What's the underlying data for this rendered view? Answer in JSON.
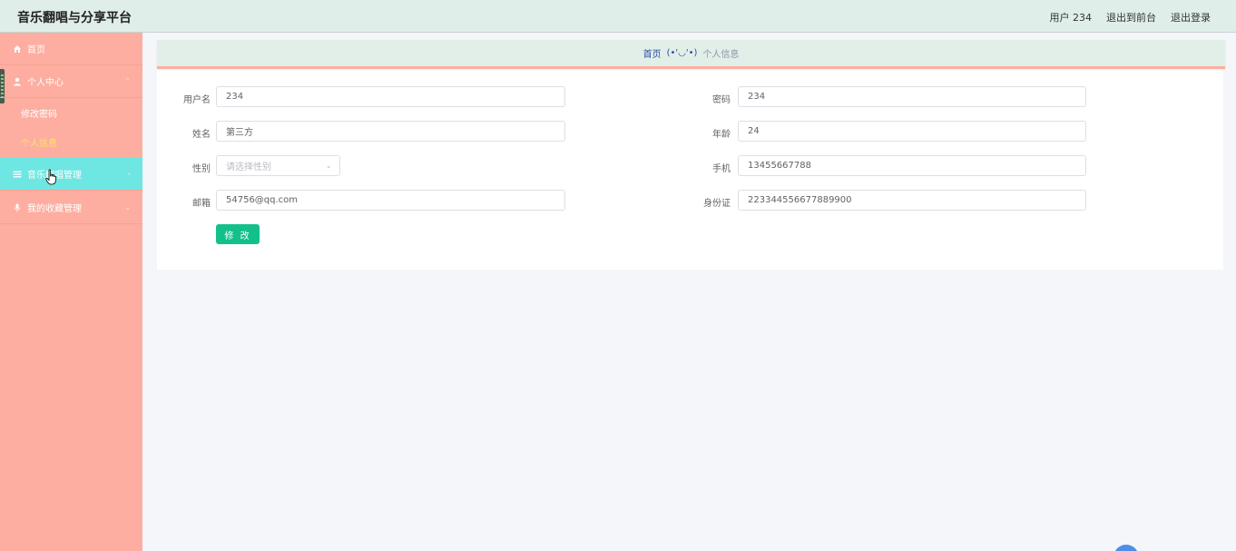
{
  "header": {
    "title": "音乐翻唱与分享平台",
    "user": "用户 234",
    "back_front": "退出到前台",
    "logout": "退出登录"
  },
  "sidebar": {
    "items": [
      {
        "label": "首页",
        "icon": "home-icon"
      },
      {
        "label": "个人中心",
        "icon": "user-icon"
      },
      {
        "label": "音乐翻唱管理",
        "icon": "list-icon"
      },
      {
        "label": "我的收藏管理",
        "icon": "microphone-icon"
      }
    ],
    "submenu": [
      {
        "label": "修改密码"
      },
      {
        "label": "个人信息"
      }
    ],
    "accent": "#fdaea0",
    "active_color": "#6ee6e2",
    "current_color": "#ffe26a"
  },
  "breadcrumb": {
    "home": "首页",
    "separator": "(•'◡'•)",
    "current": "个人信息"
  },
  "form": {
    "username_label": "用户名",
    "username_value": "234",
    "password_label": "密码",
    "password_value": "234",
    "name_label": "姓名",
    "name_value": "第三方",
    "age_label": "年龄",
    "age_value": "24",
    "gender_label": "性别",
    "gender_placeholder": "请选择性别",
    "phone_label": "手机",
    "phone_value": "13455667788",
    "email_label": "邮箱",
    "email_value": "54756@qq.com",
    "idcard_label": "身份证",
    "idcard_value": "223344556677889900",
    "submit_label": "修 改",
    "submit_color": "#13c08c"
  }
}
